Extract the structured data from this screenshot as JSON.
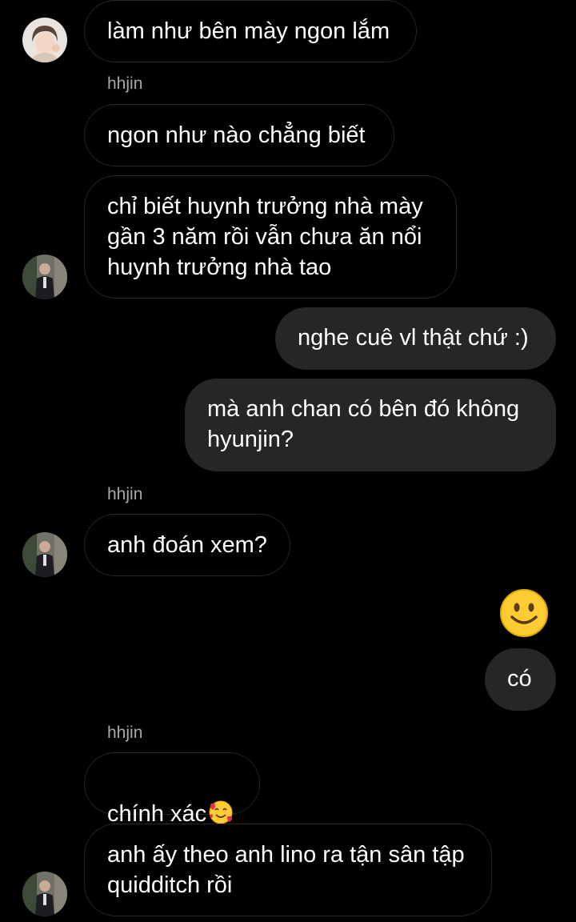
{
  "conversation": {
    "messages": [
      {
        "text": "làm như bên mày ngon lắm"
      },
      {
        "text": "ngon như nào chẳng biết"
      },
      {
        "text": "chỉ biết huynh trưởng nhà mày\ngần 3 năm rồi vẫn chưa ăn nổi\nhuynh trưởng nhà tao"
      },
      {
        "text": "nghe cuê vl thật chứ :)"
      },
      {
        "text": "mà anh chan có bên đó không\nhyunjin?"
      },
      {
        "text": "anh đoán xem?"
      },
      {
        "text": "có"
      },
      {
        "text": "chính xác"
      },
      {
        "text": "anh ấy theo anh lino ra tận sân tập\nquidditch rồi"
      }
    ],
    "sender_labels": [
      "hhjin",
      "hhjin",
      "hhjin"
    ],
    "big_emoji": "smiling-face",
    "inline_emoji": "smiling-face-with-hearts"
  },
  "colors": {
    "background": "#000000",
    "incoming_border": "#262626",
    "outgoing_bubble": "#262626",
    "sender_label": "#a8a8a8",
    "emoji_yellow": "#ffcc33"
  }
}
